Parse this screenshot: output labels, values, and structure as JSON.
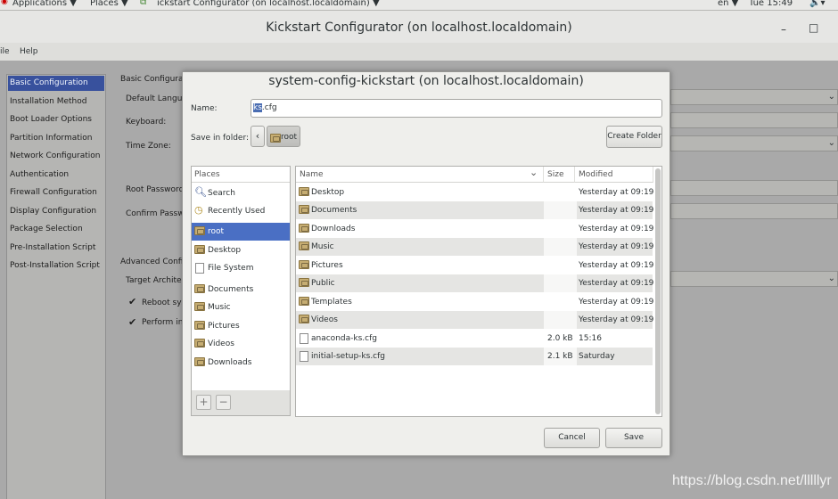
{
  "topbar": {
    "applications": "Applications ▼",
    "places": "Places ▼",
    "app_title": "ickstart Configurator (on localhost.localdomain) ▼",
    "lang": "en ▼",
    "clock": "Tue 15:49",
    "speaker": "🔈▾"
  },
  "window": {
    "title": "Kickstart Configurator (on localhost.localdomain)",
    "minimize": "–",
    "maximize": "□"
  },
  "menubar": {
    "file": "ile",
    "help": "Help"
  },
  "sidebar": {
    "items": [
      "Basic Configuration",
      "Installation Method",
      "Boot Loader Options",
      "Partition Information",
      "Network Configuration",
      "Authentication",
      "Firewall Configuration",
      "Display Configuration",
      "Package Selection",
      "Pre-Installation Script",
      "Post-Installation Script"
    ]
  },
  "background_form": {
    "section_basic": "Basic Configurat",
    "default_lang": "Default Langua",
    "keyboard": "Keyboard:",
    "timezone": "Time Zone:",
    "root_password": "Root Password",
    "confirm_password": "Confirm Passw",
    "section_advanced": "Advanced Config",
    "target_arch": "Target Architect",
    "reboot": "Reboot sys",
    "perform": "Perform ins"
  },
  "dialog": {
    "title": "system-config-kickstart (on localhost.localdomain)",
    "name_label": "Name:",
    "name_selected": "ks",
    "name_rest": ".cfg",
    "save_in_label": "Save in folder:",
    "crumb_back": "‹",
    "crumb_root": "root",
    "create_folder": "Create Folder",
    "places_header": "Places",
    "places": [
      {
        "label": "Search",
        "icon": "search-icon"
      },
      {
        "label": "Recently Used",
        "icon": "clock-icon"
      },
      {
        "label": "root",
        "icon": "home-folder-icon"
      },
      {
        "label": "Desktop",
        "icon": "folder-icon"
      },
      {
        "label": "File System",
        "icon": "drive-icon"
      },
      {
        "label": "Documents",
        "icon": "folder-icon"
      },
      {
        "label": "Music",
        "icon": "folder-icon"
      },
      {
        "label": "Pictures",
        "icon": "folder-icon"
      },
      {
        "label": "Videos",
        "icon": "folder-icon"
      },
      {
        "label": "Downloads",
        "icon": "folder-icon"
      }
    ],
    "add_btn": "+",
    "remove_btn": "−",
    "columns": {
      "name": "Name",
      "sort": "⌄",
      "size": "Size",
      "modified": "Modified"
    },
    "files": [
      {
        "name": "Desktop",
        "size": "",
        "modified": "Yesterday at 09:19",
        "type": "folder"
      },
      {
        "name": "Documents",
        "size": "",
        "modified": "Yesterday at 09:19",
        "type": "folder"
      },
      {
        "name": "Downloads",
        "size": "",
        "modified": "Yesterday at 09:19",
        "type": "folder"
      },
      {
        "name": "Music",
        "size": "",
        "modified": "Yesterday at 09:19",
        "type": "folder"
      },
      {
        "name": "Pictures",
        "size": "",
        "modified": "Yesterday at 09:19",
        "type": "folder"
      },
      {
        "name": "Public",
        "size": "",
        "modified": "Yesterday at 09:19",
        "type": "folder"
      },
      {
        "name": "Templates",
        "size": "",
        "modified": "Yesterday at 09:19",
        "type": "folder"
      },
      {
        "name": "Videos",
        "size": "",
        "modified": "Yesterday at 09:19",
        "type": "folder"
      },
      {
        "name": "anaconda-ks.cfg",
        "size": "2.0 kB",
        "modified": "15:16",
        "type": "file"
      },
      {
        "name": "initial-setup-ks.cfg",
        "size": "2.1 kB",
        "modified": "Saturday",
        "type": "file"
      }
    ],
    "cancel": "Cancel",
    "save": "Save"
  },
  "watermark": "https://blog.csdn.net/lllllyr",
  "colors": {
    "selection": "#4a6fc4",
    "sidebar_selection": "#38519d"
  }
}
